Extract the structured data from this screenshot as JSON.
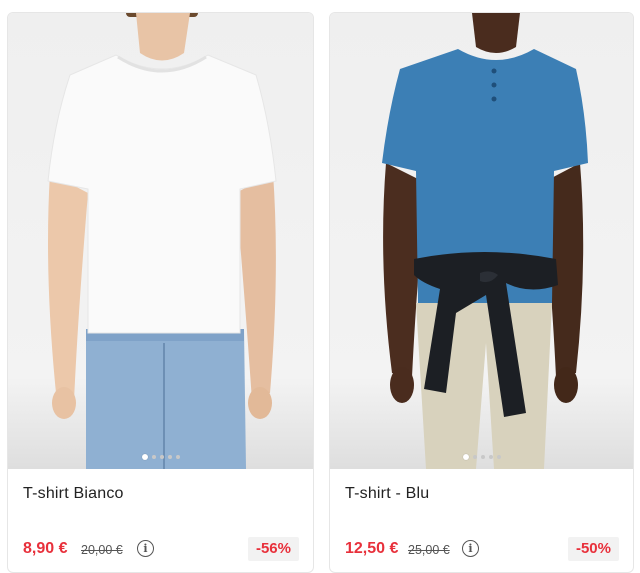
{
  "products": [
    {
      "name": "T-shirt Bianco",
      "price": "8,90 €",
      "old_price": "20,00 €",
      "discount": "-56%",
      "shirt_color": "#fafafa",
      "image_dots": 5,
      "active_dot": 1
    },
    {
      "name": "T-shirt - Blu",
      "price": "12,50 €",
      "old_price": "25,00 €",
      "discount": "-50%",
      "shirt_color": "#3c7fb5",
      "image_dots": 5,
      "active_dot": 1
    }
  ],
  "info_icon_glyph": "i",
  "colors": {
    "sale": "#e8303b",
    "badge_bg": "#f2f2f2"
  }
}
